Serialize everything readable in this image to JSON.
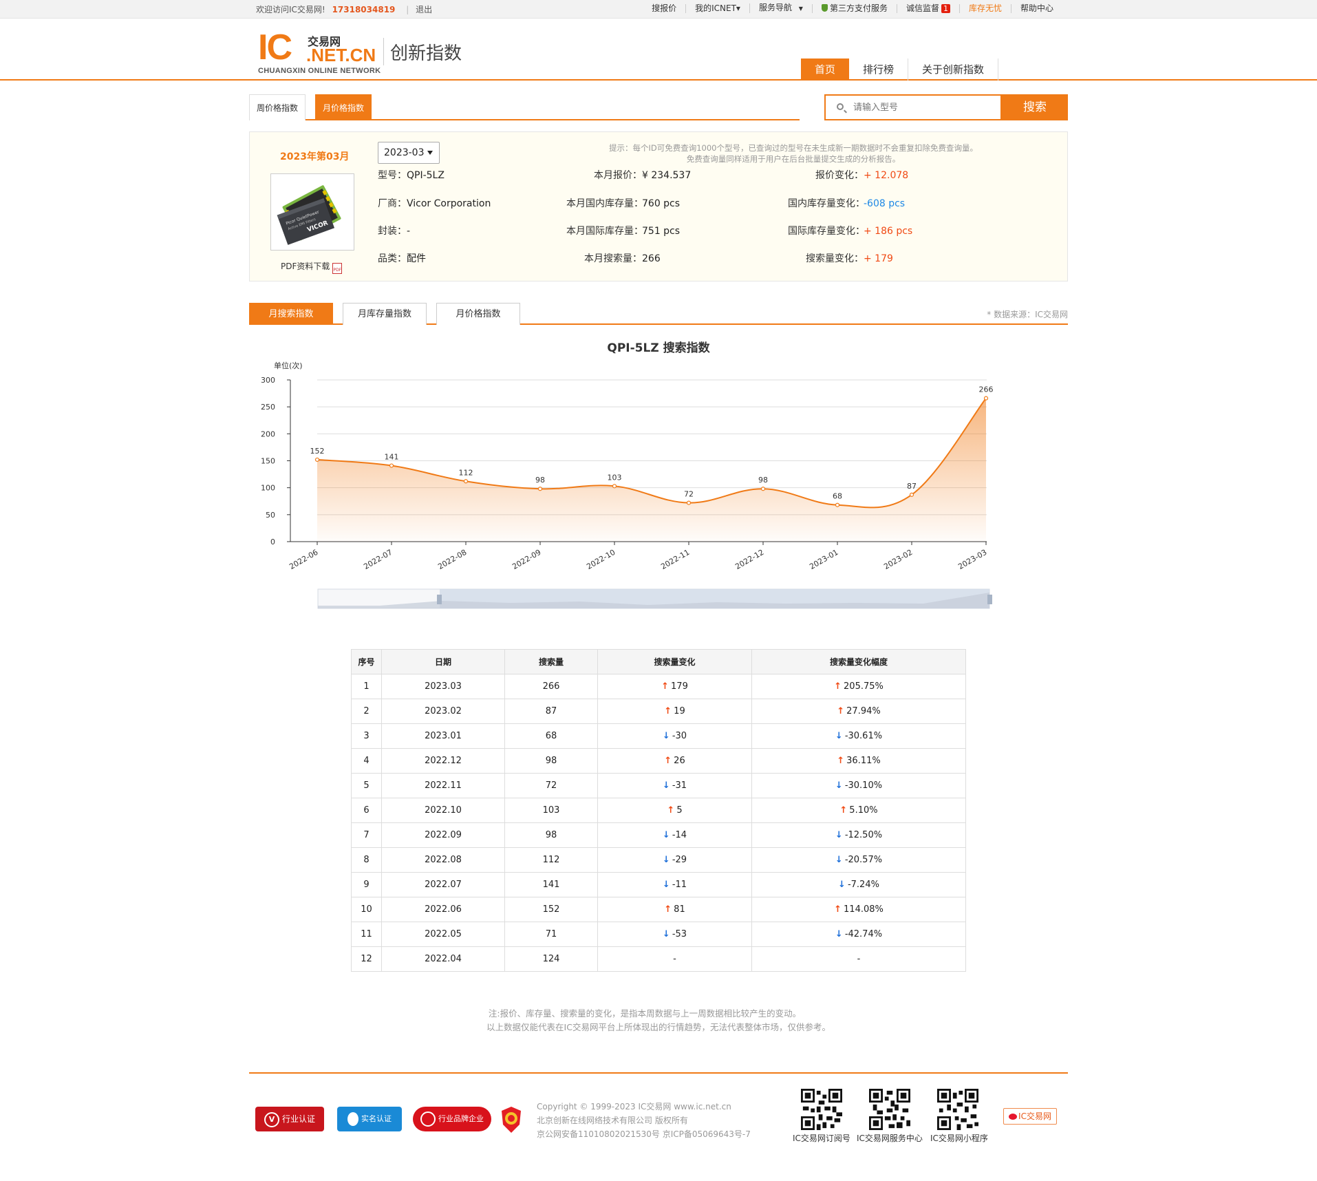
{
  "topbar": {
    "welcome": "欢迎访问IC交易网!",
    "phone": "17318034819",
    "logout": "退出",
    "links": [
      "搜报价",
      "我的ICNET▾",
      "服务导航",
      "第三方支付服务",
      "诚信监督",
      "库存无忧",
      "帮助中心"
    ],
    "nav_arrow": "▼",
    "badge_count": "1"
  },
  "header": {
    "logo_ic": "IC",
    "logo_cn": "交易网",
    "logo_domain": ".NET.CN",
    "logo_eng": "CHUANGXIN ONLINE NETWORK",
    "site_title": "创新指数",
    "nav": [
      "首页",
      "排行榜",
      "关于创新指数"
    ]
  },
  "subtabs": [
    "周价格指数",
    "月价格指数"
  ],
  "search": {
    "placeholder": "请输入型号",
    "button": "搜索"
  },
  "info": {
    "period": "2023年第03月",
    "select_value": "2023-03",
    "pdf_label": "PDF资料下载",
    "pdf_icon_text": "PDF",
    "tip_line1": "提示：每个ID可免费查询1000个型号，已查询过的型号在未生成新一期数据时不会重复扣除免费查询量。",
    "tip_line2": "免费查询量同样适用于用户在后台批量提交生成的分析报告。",
    "model_label": "型号：",
    "model": "QPI-5LZ",
    "mfr_label": "厂商：",
    "mfr": "Vicor Corporation",
    "pkg_label": "封装：",
    "pkg": "-",
    "cat_label": "品类：",
    "cat": "配件",
    "price_label": "本月报价：",
    "price": "¥ 234.537",
    "dom_stock_label": "本月国内库存量：",
    "dom_stock": "760  pcs",
    "intl_stock_label": "本月国际库存量：",
    "intl_stock": "751  pcs",
    "search_label": "本月搜索量：",
    "search_val": "266",
    "price_chg_label": "报价变化：",
    "price_chg": "+ 12.078",
    "dom_chg_label": "国内库存量变化：",
    "dom_chg": "-608   pcs",
    "intl_chg_label": "国际库存量变化：",
    "intl_chg": "+ 186  pcs",
    "search_chg_label": "搜索量变化：",
    "search_chg": "+ 179"
  },
  "index_tabs": [
    "月搜索指数",
    "月库存量指数",
    "月价格指数"
  ],
  "source": "* 数据来源：IC交易网",
  "chart_data": {
    "type": "area",
    "title": "QPI-5LZ 搜索指数",
    "ylabel": "单位(次)",
    "xlabel": "",
    "ylim": [
      0,
      300
    ],
    "yticks": [
      0,
      50,
      100,
      150,
      200,
      250,
      300
    ],
    "grid": true,
    "categories": [
      "2022-06",
      "2022-07",
      "2022-08",
      "2022-09",
      "2022-10",
      "2022-11",
      "2022-12",
      "2023-01",
      "2023-02",
      "2023-03"
    ],
    "values": [
      152,
      141,
      112,
      98,
      103,
      72,
      98,
      68,
      87,
      266
    ],
    "color": "#f07a16"
  },
  "table": {
    "headers": [
      "序号",
      "日期",
      "搜索量",
      "搜索量变化",
      "搜索量变化幅度"
    ],
    "rows": [
      {
        "no": "1",
        "date": "2023.03",
        "val": "266",
        "dir": "up",
        "chg": "179",
        "pct": "205.75%"
      },
      {
        "no": "2",
        "date": "2023.02",
        "val": "87",
        "dir": "up",
        "chg": "19",
        "pct": "27.94%"
      },
      {
        "no": "3",
        "date": "2023.01",
        "val": "68",
        "dir": "down",
        "chg": "-30",
        "pct": "-30.61%"
      },
      {
        "no": "4",
        "date": "2022.12",
        "val": "98",
        "dir": "up",
        "chg": "26",
        "pct": "36.11%"
      },
      {
        "no": "5",
        "date": "2022.11",
        "val": "72",
        "dir": "down",
        "chg": "-31",
        "pct": "-30.10%"
      },
      {
        "no": "6",
        "date": "2022.10",
        "val": "103",
        "dir": "up",
        "chg": "5",
        "pct": "5.10%"
      },
      {
        "no": "7",
        "date": "2022.09",
        "val": "98",
        "dir": "down",
        "chg": "-14",
        "pct": "-12.50%"
      },
      {
        "no": "8",
        "date": "2022.08",
        "val": "112",
        "dir": "down",
        "chg": "-29",
        "pct": "-20.57%"
      },
      {
        "no": "9",
        "date": "2022.07",
        "val": "141",
        "dir": "down",
        "chg": "-11",
        "pct": "-7.24%"
      },
      {
        "no": "10",
        "date": "2022.06",
        "val": "152",
        "dir": "up",
        "chg": "81",
        "pct": "114.08%"
      },
      {
        "no": "11",
        "date": "2022.05",
        "val": "71",
        "dir": "down",
        "chg": "-53",
        "pct": "-42.74%"
      },
      {
        "no": "12",
        "date": "2022.04",
        "val": "124",
        "dir": "none",
        "chg": "-",
        "pct": "-"
      }
    ]
  },
  "note": {
    "line1": "注:报价、库存量、搜索量的变化，是指本周数据与上一周数据相比较产生的变动。",
    "line2": "以上数据仅能代表在IC交易网平台上所体现出的行情趋势，无法代表整体市场，仅供参考。"
  },
  "footer": {
    "badges": [
      "行业认证",
      "实名认证",
      "行业品牌企业"
    ],
    "copyright": "Copyright © 1999-2023 IC交易网 www.ic.net.cn",
    "company": "北京创新在线网络技术有限公司 版权所有",
    "icp": "京公网安备11010802021530号    京ICP备05069643号-7",
    "qr_labels": [
      "IC交易网订阅号",
      "IC交易网服务中心",
      "IC交易网小程序"
    ],
    "weibo": "IC交易网"
  }
}
